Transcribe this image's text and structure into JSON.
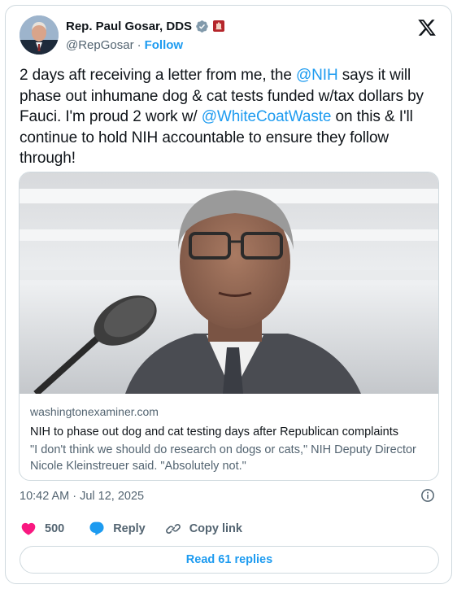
{
  "author": {
    "display_name": "Rep. Paul Gosar, DDS",
    "handle": "@RepGosar",
    "follow_label": "Follow",
    "separator": "·"
  },
  "tweet": {
    "text_parts": [
      "2 days aft receiving a letter from me, the ",
      "@NIH",
      " says it will phase out inhumane dog & cat tests funded w/tax dollars by Fauci.  I'm proud 2  work w/ ",
      "@WhiteCoatWaste",
      " on this & I'll continue to hold NIH accountable to ensure they follow through!"
    ]
  },
  "link_card": {
    "domain": "washingtonexaminer.com",
    "headline": "NIH to phase out dog and cat testing days after Republican complaints",
    "description": "\"I don't think we should do research on dogs or cats,\" NIH Deputy Director Nicole Kleinstreuer said. \"Absolutely not.\""
  },
  "meta": {
    "time": "10:42 AM",
    "separator": "·",
    "date": "Jul 12, 2025"
  },
  "actions": {
    "like_count": "500",
    "reply_label": "Reply",
    "copy_label": "Copy link"
  },
  "read_replies_label": "Read 61 replies",
  "colors": {
    "accent": "#1d9bf0",
    "like": "#f91880",
    "muted": "#536471",
    "border": "#cfd9de"
  },
  "icons": [
    "verified-badge-icon",
    "government-affiliation-icon",
    "x-logo-icon",
    "info-icon",
    "heart-icon",
    "reply-bubble-icon",
    "link-icon"
  ]
}
